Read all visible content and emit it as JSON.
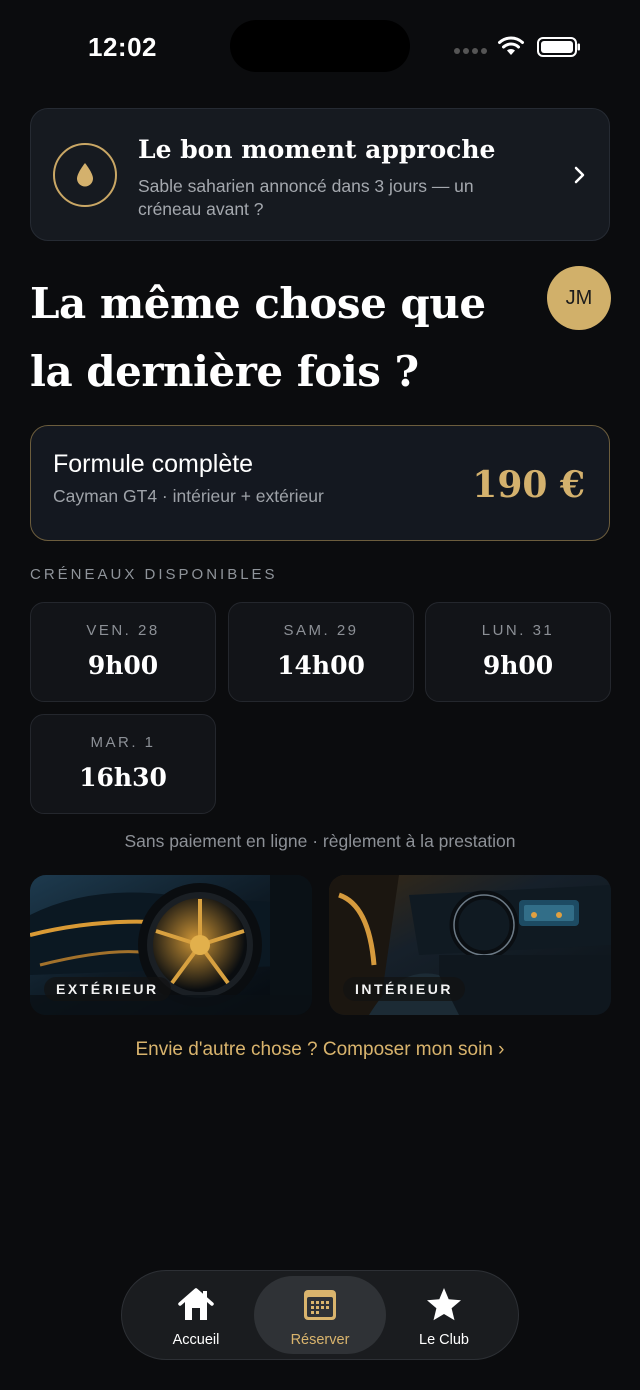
{
  "status_bar": {
    "time": "12:02"
  },
  "alert": {
    "title": "Le bon moment approche",
    "subtitle": "Sable saharien annoncé dans 3 jours — un créneau avant ?",
    "icon": "drop-icon"
  },
  "headline": "La même chose que la dernière fois ?",
  "avatar_initials": "JM",
  "formula": {
    "title": "Formule complète",
    "description": "Cayman GT4 · intérieur + extérieur",
    "price": "190 €"
  },
  "slots": {
    "label": "CRÉNEAUX DISPONIBLES",
    "items": [
      {
        "day": "VEN. 28",
        "time": "9h00"
      },
      {
        "day": "SAM. 29",
        "time": "14h00"
      },
      {
        "day": "LUN. 31",
        "time": "9h00"
      },
      {
        "day": "MAR. 1",
        "time": "16h30"
      }
    ]
  },
  "payment_note": "Sans paiement en ligne · règlement à la prestation",
  "photos": [
    {
      "label": "EXTÉRIEUR"
    },
    {
      "label": "INTÉRIEUR"
    }
  ],
  "compose_link": "Envie d'autre chose ? Composer mon soin ›",
  "tabbar": {
    "items": [
      {
        "label": "Accueil",
        "icon": "home-icon",
        "active": false
      },
      {
        "label": "Réserver",
        "icon": "calendar-icon",
        "active": true
      },
      {
        "label": "Le Club",
        "icon": "star-icon",
        "active": false
      }
    ]
  },
  "colors": {
    "accent": "#d9b46d",
    "background": "#0b0c0e",
    "card": "#161a20"
  }
}
